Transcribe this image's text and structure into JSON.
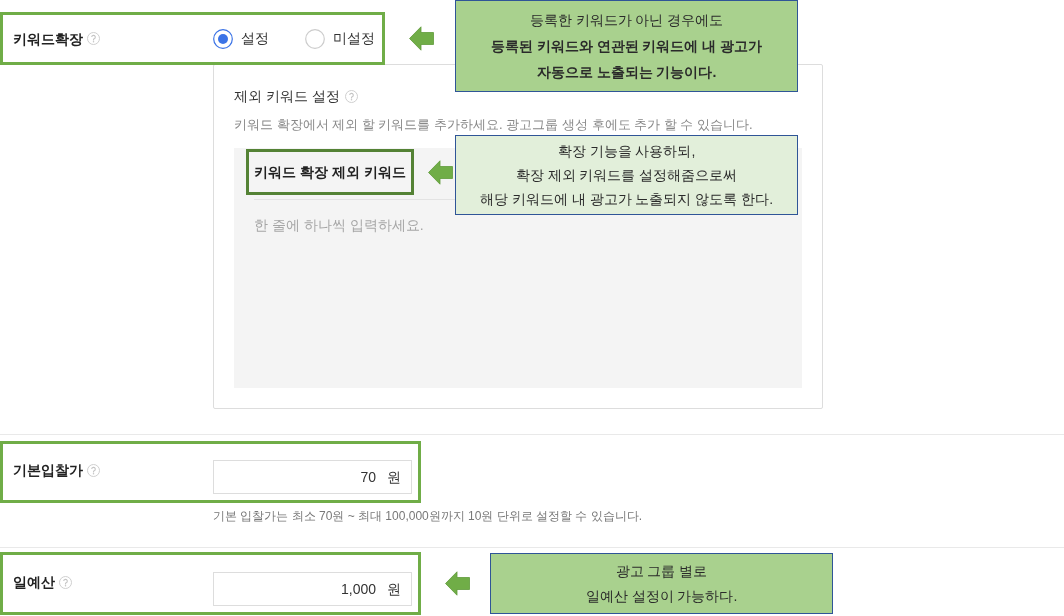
{
  "keyword_expansion": {
    "label": "키워드확장",
    "highlighted": true,
    "options": [
      {
        "label": "설정",
        "selected": true
      },
      {
        "label": "미설정",
        "selected": false
      }
    ],
    "callout": {
      "color": "#a9d18e",
      "lines": [
        "등록한 키워드가 아닌 경우에도",
        "**등록된 키워드와 연관된 키워드에 내 광고가**",
        "**자동으로 노출되는 기능이다.**"
      ]
    }
  },
  "excluded_keywords": {
    "title": "제외 키워드 설정",
    "description": "키워드 확장에서 제외 할 키워드를 추가하세요. 광고그룹 생성 후에도 추가 할 수 있습니다.",
    "list_header": {
      "label": "키워드 확장 제외 키워드",
      "highlighted": true
    },
    "placeholder": "한 줄에 하나씩 입력하세요.",
    "callout": {
      "color": "#e2efda",
      "lines": [
        "확장 기능을 사용하되,",
        "확장 제외 키워드를 설정해줌으로써",
        "해당 키워드에 내 광고가 노출되지 않도록 한다."
      ]
    }
  },
  "default_bid": {
    "label": "기본입찰가",
    "highlighted": true,
    "value": "70",
    "unit": "원",
    "help": "기본 입찰가는 최소 70원 ~ 최대 100,000원까지 10원 단위로 설정할 수 있습니다."
  },
  "daily_budget": {
    "label": "일예산",
    "highlighted": true,
    "value": "1,000",
    "unit": "원",
    "callout": {
      "color": "#a9d18e",
      "lines": [
        "광고 그룹 별로",
        "일예산 설정이 가능하다."
      ]
    }
  }
}
